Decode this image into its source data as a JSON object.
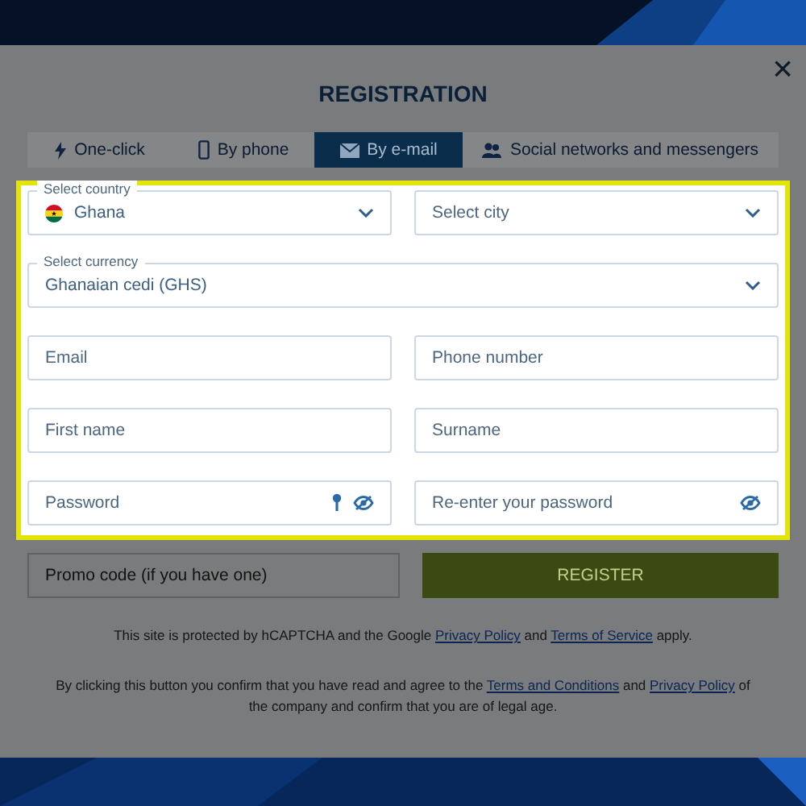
{
  "modal": {
    "title": "REGISTRATION",
    "close": "×"
  },
  "tabs": [
    {
      "label": "One-click",
      "kind": "bolt",
      "selected": false
    },
    {
      "label": "By phone",
      "kind": "phone",
      "selected": false
    },
    {
      "label": "By e-mail",
      "kind": "mail",
      "selected": true
    },
    {
      "label": "Social networks and messengers",
      "kind": "people",
      "selected": false
    }
  ],
  "highlighted_rows": [
    [
      {
        "kind": "select",
        "label": "Select country",
        "value": "Ghana",
        "flag": true
      },
      {
        "kind": "select",
        "placeholder": "Select city"
      }
    ],
    [
      {
        "kind": "select",
        "label": "Select currency",
        "value": "Ghanaian cedi (GHS)"
      }
    ],
    [
      {
        "kind": "text",
        "placeholder": "Email"
      },
      {
        "kind": "text",
        "placeholder": "Phone number"
      }
    ],
    [
      {
        "kind": "text",
        "placeholder": "First name"
      },
      {
        "kind": "text",
        "placeholder": "Surname"
      }
    ],
    [
      {
        "kind": "password",
        "placeholder": "Password",
        "key_icon": true
      },
      {
        "kind": "password",
        "placeholder": "Re-enter your password",
        "key_icon": false
      }
    ]
  ],
  "promo": {
    "placeholder": "Promo code (if you have one)"
  },
  "register_button": {
    "label": "REGISTER",
    "disabled": true
  },
  "notes": [
    [
      {
        "kind": "text",
        "text": "This site is protected by hCAPTCHA and the Google "
      },
      {
        "kind": "link",
        "text": "Privacy Policy"
      },
      {
        "kind": "text",
        "text": " and "
      },
      {
        "kind": "link",
        "text": "Terms of Service"
      },
      {
        "kind": "text",
        "text": " apply."
      }
    ],
    [
      {
        "kind": "text",
        "text": "By clicking this button you confirm that you have read and agree to the "
      },
      {
        "kind": "link",
        "text": "Terms and Conditions"
      },
      {
        "kind": "text",
        "text": " and "
      },
      {
        "kind": "link",
        "text": "Privacy Policy"
      },
      {
        "kind": "text",
        "text": " of the company and confirm that you are of legal age."
      }
    ]
  ]
}
